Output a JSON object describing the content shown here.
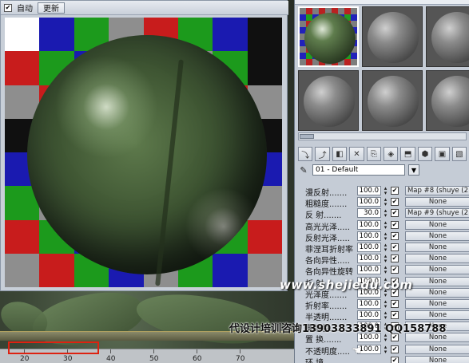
{
  "preview": {
    "auto_label": "自动",
    "auto_checked": "✔",
    "update_button": "更新"
  },
  "checker_colors": [
    "#1c9a1c",
    "#1a1ab0",
    "#c81c1c",
    "#8e8e8e",
    "#101010",
    "#ffffff"
  ],
  "material_editor": {
    "material_name": "01 - Default",
    "dropdown_arrow": "▼",
    "eyedropper_icon": "eyedropper-icon",
    "toolbar_icons": [
      "get-material-icon",
      "put-to-scene-icon",
      "assign-icon",
      "delete-icon",
      "copy-icon",
      "unique-icon",
      "put-to-library-icon",
      "effects-channel-icon",
      "show-map-icon",
      "show-end-icon"
    ],
    "toolbar_glyphs": [
      "⤵",
      "⤴",
      "◧",
      "✕",
      "⎘",
      "◈",
      "⬒",
      "⬢",
      "▣",
      "▧"
    ],
    "maps": [
      {
        "label": "漫反射.......",
        "value": "100.0",
        "checked": "✔",
        "map": "Map #8 (shuye (2"
      },
      {
        "label": "粗糙度.......",
        "value": "100.0",
        "checked": "✔",
        "map": "None"
      },
      {
        "label": "反  射.......",
        "value": "30.0",
        "checked": "✔",
        "map": "Map #9 (shuye (2"
      },
      {
        "label": "高光光泽.....",
        "value": "100.0",
        "checked": "✔",
        "map": "None"
      },
      {
        "label": "反射光泽.....",
        "value": "100.0",
        "checked": "✔",
        "map": "None"
      },
      {
        "label": "菲涅耳折射率",
        "value": "100.0",
        "checked": "✔",
        "map": "None"
      },
      {
        "label": "各向异性.....",
        "value": "100.0",
        "checked": "✔",
        "map": "None"
      },
      {
        "label": "各向异性旋转",
        "value": "100.0",
        "checked": "✔",
        "map": "None"
      },
      {
        "label": "折  射.......",
        "value": "100.0",
        "checked": "✔",
        "map": "None"
      },
      {
        "label": "光泽度.......",
        "value": "100.0",
        "checked": "✔",
        "map": "None"
      },
      {
        "label": "折射率.......",
        "value": "100.0",
        "checked": "✔",
        "map": "None"
      },
      {
        "label": "半透明.......",
        "value": "100.0",
        "checked": "✔",
        "map": "None"
      },
      {
        "label": "雾颜色.......",
        "value": "100.0",
        "checked": "✔",
        "map": "None"
      },
      {
        "label": "置  换.......",
        "value": "100.0",
        "checked": "✔",
        "map": "None"
      },
      {
        "label": "不透明度.....",
        "value": "100.0",
        "checked": "✔",
        "map": "None"
      },
      {
        "label": "环  境.............",
        "value": "",
        "checked": "✔",
        "map": "None"
      }
    ]
  },
  "timeline": {
    "ticks": [
      "20",
      "30",
      "40",
      "50",
      "60",
      "70"
    ]
  },
  "overlay": {
    "watermark": "www.shejiedu.com",
    "ad_text": "代设计培训咨询13903833891  QQ158788",
    "cursor_icon": "hand-cursor-icon",
    "cursor_glyph": "☚"
  }
}
